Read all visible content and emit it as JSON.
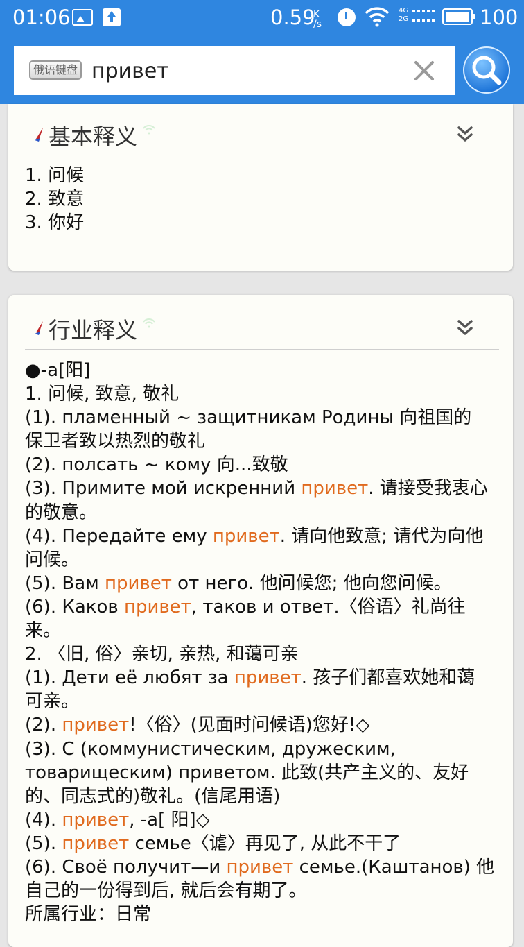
{
  "status_bar": {
    "time": "01:06",
    "speed": "0.59",
    "speed_unit_top": "K",
    "speed_unit_bottom": "/s",
    "net_top": "4G",
    "net_bottom": "2G",
    "battery": "100",
    "icons": [
      "image-icon",
      "upload-icon",
      "alarm-icon",
      "wifi-icon",
      "signal-icon",
      "battery-icon"
    ]
  },
  "search": {
    "keyboard_label": "俄语键盘",
    "query": "привет",
    "clear_icon": "close-icon",
    "search_icon": "search-icon"
  },
  "colors": {
    "primary": "#2f86e0",
    "highlight": "#e06a1e",
    "card_bg": "#fdfdf8",
    "page_bg": "#e6e6e6"
  },
  "basic_card": {
    "title": "基本释义",
    "lines": [
      "1. 问候",
      "2. 致意",
      "3. 你好"
    ]
  },
  "industry_card": {
    "title": "行业释义",
    "lines": [
      [
        {
          "t": "●-a[阳]"
        }
      ],
      [
        {
          "t": "1. 问候, 致意, 敬礼"
        }
      ],
      [
        {
          "t": "(1). пламенный ~ защитникам Родины 向祖国的"
        }
      ],
      [
        {
          "t": "保卫者致以热烈的敬礼"
        }
      ],
      [
        {
          "t": "(2). полсать ~ кому 向...致敬"
        }
      ],
      [
        {
          "t": "(3). Примите мой искренний "
        },
        {
          "t": "привет",
          "h": true
        },
        {
          "t": ". 请接受我衷心"
        }
      ],
      [
        {
          "t": "的敬意。"
        }
      ],
      [
        {
          "t": "(4). Передайте ему "
        },
        {
          "t": "привет",
          "h": true
        },
        {
          "t": ". 请向他致意; 请代为向他"
        }
      ],
      [
        {
          "t": "问候。"
        }
      ],
      [
        {
          "t": "(5). Вам "
        },
        {
          "t": "привет",
          "h": true
        },
        {
          "t": " от него. 他问候您; 他向您问候。"
        }
      ],
      [
        {
          "t": "(6). Каков "
        },
        {
          "t": "привет",
          "h": true
        },
        {
          "t": ", таков и ответ.〈俗语〉礼尚往"
        }
      ],
      [
        {
          "t": "来。"
        }
      ],
      [
        {
          "t": "2. 〈旧, 俗〉亲切, 亲热, 和蔼可亲"
        }
      ],
      [
        {
          "t": "(1). Дети её любят за "
        },
        {
          "t": "привет",
          "h": true
        },
        {
          "t": ". 孩子们都喜欢她和蔼"
        }
      ],
      [
        {
          "t": "可亲。"
        }
      ],
      [
        {
          "t": "(2). "
        },
        {
          "t": "привет",
          "h": true
        },
        {
          "t": "!〈俗〉(见面时问候语)您好!◇"
        }
      ],
      [
        {
          "t": "(3). С (коммунистическим, дружеским,"
        }
      ],
      [
        {
          "t": "товарищеским) приветом. 此致(共产主义的、友好"
        }
      ],
      [
        {
          "t": "的、同志式的)敬礼。(信尾用语)"
        }
      ],
      [
        {
          "t": "(4). "
        },
        {
          "t": "привет",
          "h": true
        },
        {
          "t": ", -a[ 阳]◇"
        }
      ],
      [
        {
          "t": "(5). "
        },
        {
          "t": "привет",
          "h": true
        },
        {
          "t": " семье〈谑〉再见了, 从此不干了"
        }
      ],
      [
        {
          "t": "(6). Своё получит—и "
        },
        {
          "t": "привет",
          "h": true
        },
        {
          "t": " семье.(Каштанов) 他"
        }
      ],
      [
        {
          "t": "自己的一份得到后, 就后会有期了。"
        }
      ],
      [
        {
          "t": "所属行业：日常"
        }
      ]
    ]
  }
}
